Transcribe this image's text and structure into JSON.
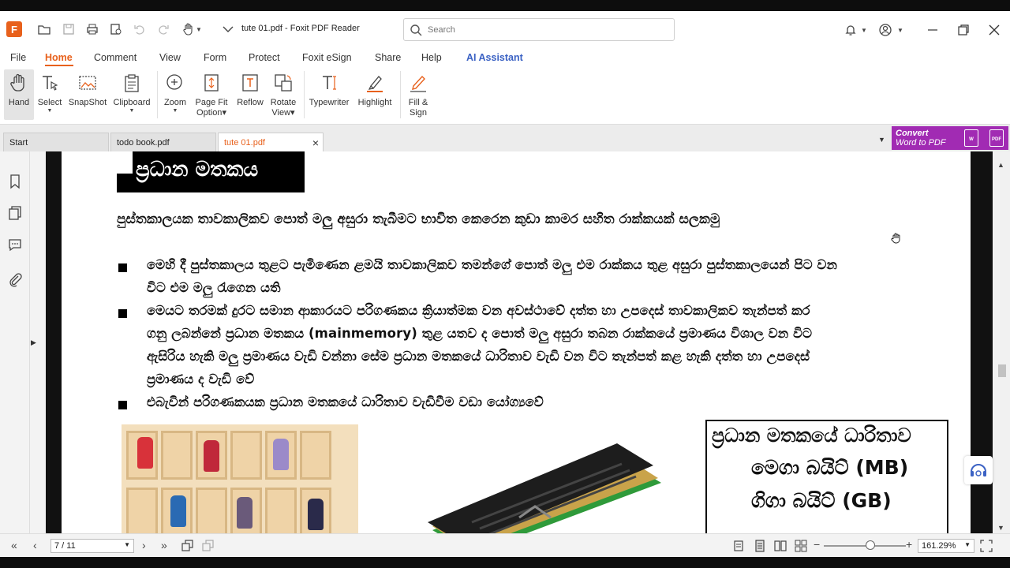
{
  "app": {
    "title": "tute 01.pdf - Foxit PDF Reader",
    "search_placeholder": "Search"
  },
  "menu": [
    "File",
    "Home",
    "Comment",
    "View",
    "Form",
    "Protect",
    "Foxit eSign",
    "Share",
    "Help",
    "AI Assistant"
  ],
  "ribbon": {
    "hand": "Hand",
    "select": "Select",
    "snapshot": "SnapShot",
    "clipboard": "Clipboard",
    "zoom": "Zoom",
    "page_fit_1": "Page Fit",
    "page_fit_2": "Option",
    "reflow": "Reflow",
    "rotate_1": "Rotate",
    "rotate_2": "View",
    "typewriter": "Typewriter",
    "highlight": "Highlight",
    "fill_1": "Fill &",
    "fill_2": "Sign"
  },
  "tabs": [
    {
      "label": "Start"
    },
    {
      "label": "todo book.pdf"
    },
    {
      "label": "tute 01.pdf"
    }
  ],
  "ad": {
    "line1": "Convert",
    "line2": "Word to PDF"
  },
  "document": {
    "heading": "ප්‍රධාන මතකය",
    "intro": "පුස්තකාලයක තාවකාලිකව පොත් මලු අසුරා තැබීමට භාවිත කෙරෙන කුඩා කාමර සහිත රාක්කයක් සලකමු",
    "bullet1_l1": "මෙහි දී පුස්තකාලය තුළට පැමිණෙන ළමයි තාවකාලිකව තමන්ගේ පොත් මලු එම රාක්කය තුළ අසුරා පුස්තකාලයෙන් පිට වන",
    "bullet1_l2": "විට එම මලු රැගෙන යති",
    "bullet2_l1": "මෙයට තරමක් දුරට සමාන ආකාරයට පරිගණකය ක්‍රියාත්මක වන අවස්ථාවේ දත්ත හා උපදෙස් තාවකාලිකව තැන්පත් කර",
    "bullet2_l2": "ගනු ලබන්නේ ප්‍රධාන මතකය (mainmemory) තුළ යතව ද පොත් මලු අසුරා තබන රාක්කයේ ප්‍රමාණය විශාල වන විට",
    "bullet2_l3": "ඇසිරිය හැකි මලු ප්‍රමාණය වැඩි වන්නා සේම ප්‍රධාන මතකයේ ධාරිතාව වැඩි වන විට තැන්පත් කළ හැකි දත්ත හා උපදෙස්",
    "bullet2_l4": "ප්‍රමාණය ද වැඩි වේ",
    "bullet3_l1": "එබැවින් පරිගණකයක ප්‍රධාන මතකයේ ධාරිතාව වැඩිවීම වඩා යෝග්‍යවේ",
    "capacity_title": "ප්‍රධාන මතකයේ ධාරිතාව",
    "capacity_mb": "මෙගා බයිට් (MB)",
    "capacity_gb": "ගිගා බයිට් (GB)"
  },
  "status": {
    "page": "7 / 11",
    "zoom": "161.29%"
  },
  "colors": {
    "accent": "#e8611c",
    "ai": "#3b62c4",
    "ad": "#a12bb3"
  }
}
